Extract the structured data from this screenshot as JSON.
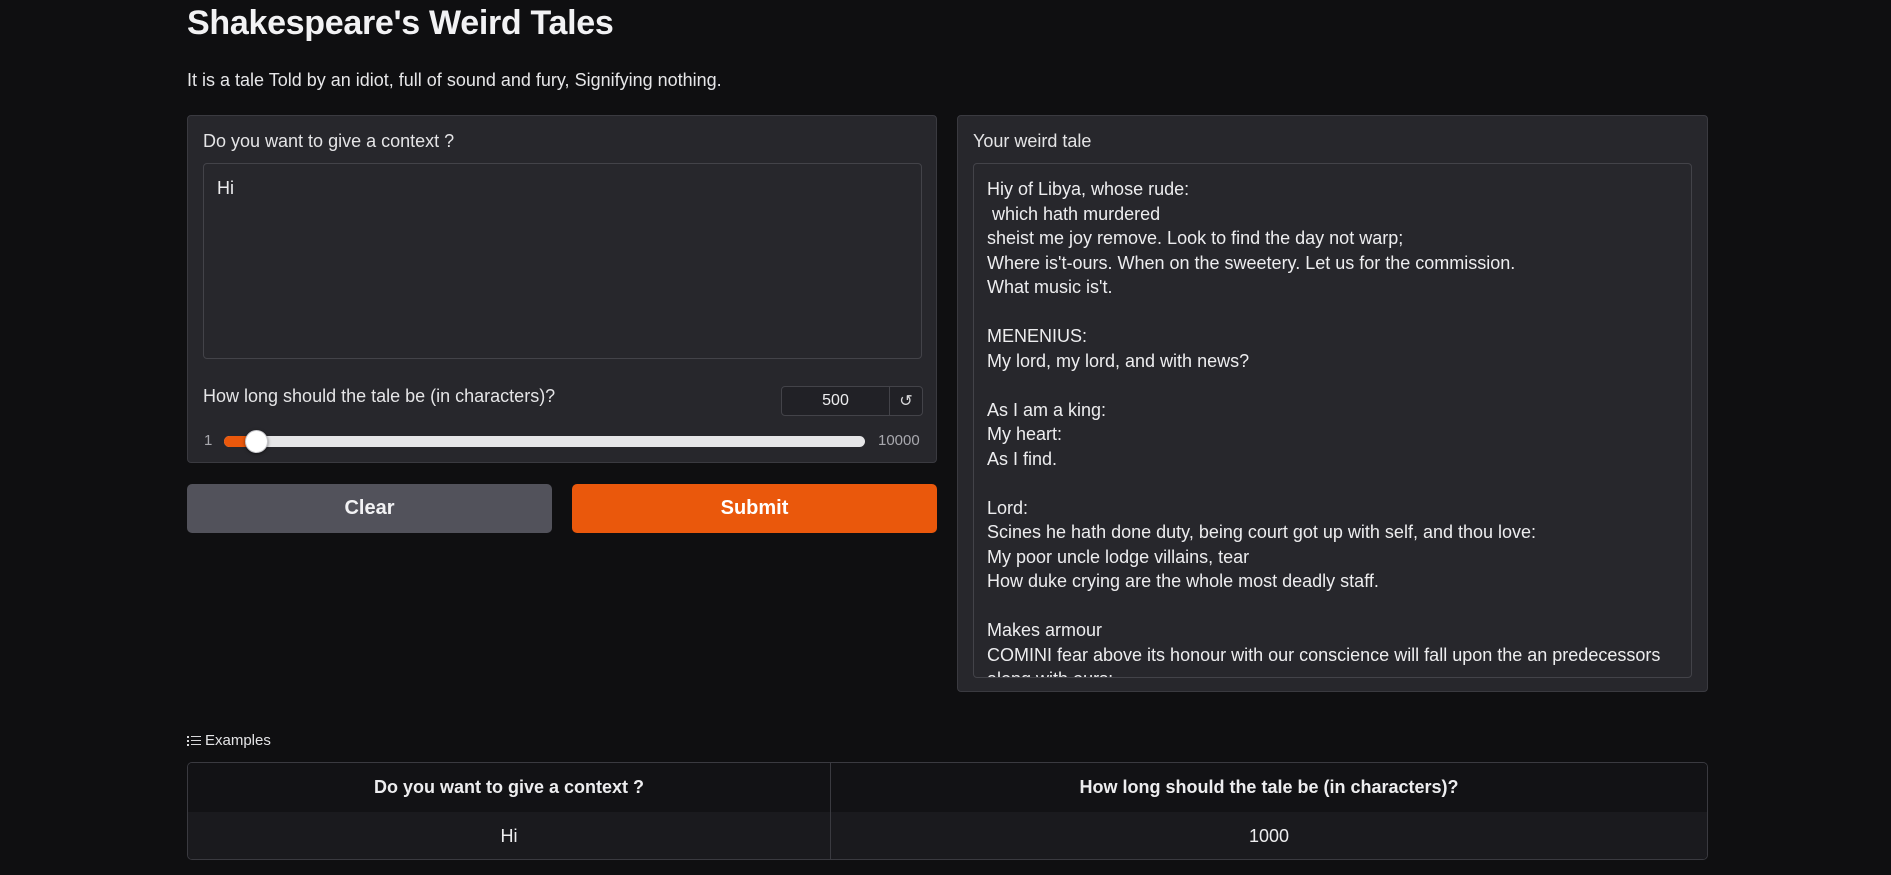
{
  "page": {
    "title": "Shakespeare's Weird Tales",
    "description": "It is a tale Told by an idiot, full of sound and fury, Signifying nothing."
  },
  "input_panel": {
    "context_label": "Do you want to give a context ?",
    "context_value": "Hi",
    "length_label": "How long should the tale be (in characters)?",
    "length_value": "500",
    "reset_icon_glyph": "↺",
    "slider_min": "1",
    "slider_max": "10000",
    "slider_level": 0.05
  },
  "buttons": {
    "clear_label": "Clear",
    "submit_label": "Submit"
  },
  "output_panel": {
    "label": "Your weird tale",
    "text": "Hiy of Libya, whose rude:\n which hath murdered\nsheist me joy remove. Look to find the day not warp;\nWhere is't-ours. When on the sweetery. Let us for the commission.\nWhat music is't.\n\nMENENIUS:\nMy lord, my lord, and with news?\n\nAs I am a king:\nMy heart:\nAs I find.\n\nLord:\nScines he hath done duty, being court got up with self, and thou love:\nMy poor uncle lodge villains, tear\nHow duke crying are the whole most deadly staff.\n\nMakes armour\nCOMINI fear above its honour with our conscience will fall upon the an predecessors\nalong with ours;"
  },
  "examples": {
    "header": "Examples",
    "columns": [
      "Do you want to give a context ?",
      "How long should the tale be (in characters)?"
    ],
    "rows": [
      [
        "Hi",
        "1000"
      ]
    ]
  },
  "colors": {
    "accent": "#ea580c",
    "background": "#0f0f11",
    "panel": "#27272c",
    "secondary_button": "#52525b"
  },
  "icons": {
    "reset": "reset-icon",
    "examples": "list-icon"
  }
}
